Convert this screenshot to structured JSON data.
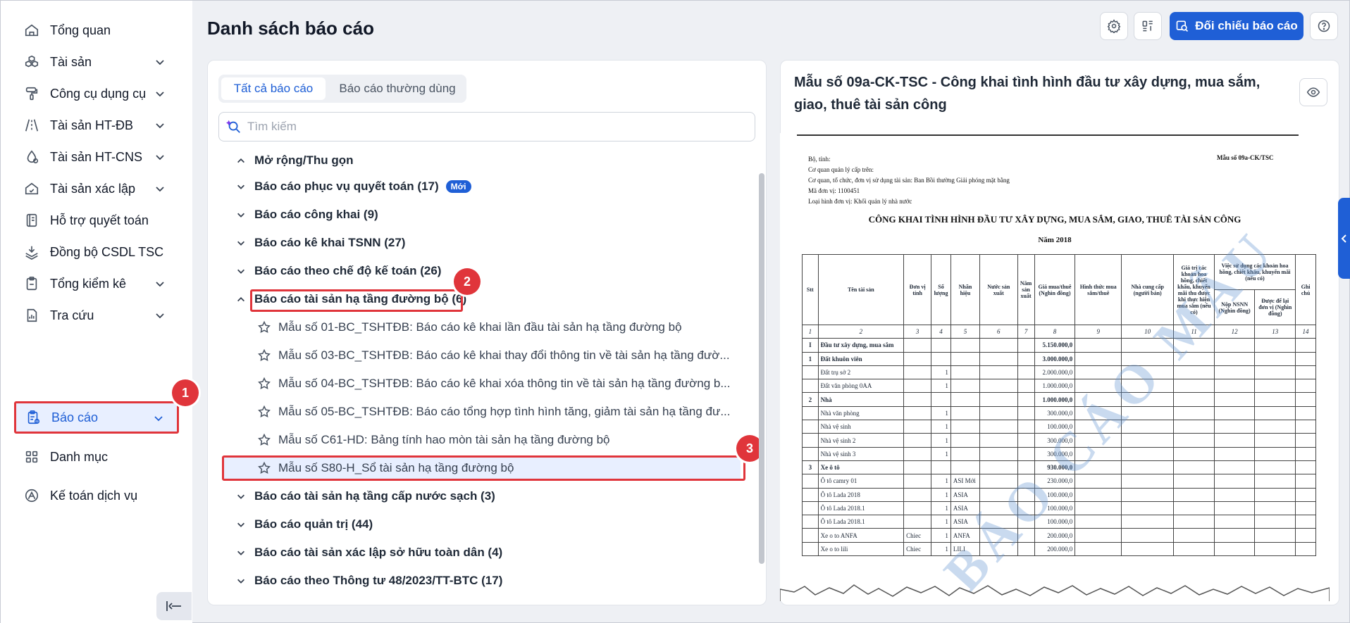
{
  "sidebar": {
    "items": [
      {
        "label": "Tổng quan",
        "icon": "home-icon",
        "chevron": false
      },
      {
        "label": "Tài sản",
        "icon": "cubes-icon",
        "chevron": true
      },
      {
        "label": "Công cụ dụng cụ",
        "icon": "paint-roller-icon",
        "chevron": true
      },
      {
        "label": "Tài sản HT-ĐB",
        "icon": "road-icon",
        "chevron": true
      },
      {
        "label": "Tài sản HT-CNS",
        "icon": "water-drop-icon",
        "chevron": true
      },
      {
        "label": "Tài sản xác lập",
        "icon": "house-check-icon",
        "chevron": true
      },
      {
        "label": "Hỗ trợ quyết toán",
        "icon": "book-icon",
        "chevron": false
      },
      {
        "label": "Đồng bộ CSDL TSC",
        "icon": "layers-sync-icon",
        "chevron": false
      },
      {
        "label": "Tổng kiểm kê",
        "icon": "clipboard-icon",
        "chevron": true
      },
      {
        "label": "Tra cứu",
        "icon": "file-chart-icon",
        "chevron": true
      },
      {
        "label": "Báo cáo",
        "icon": "report-icon",
        "chevron": true
      },
      {
        "label": "Danh mục",
        "icon": "grid-icon",
        "chevron": false
      },
      {
        "label": "Kế toán dịch vụ",
        "icon": "service-icon",
        "chevron": false
      }
    ]
  },
  "header": {
    "title": "Danh sách báo cáo",
    "compare_button": "Đối chiếu báo cáo"
  },
  "left_panel": {
    "tabs": [
      "Tất cả báo cáo",
      "Báo cáo thường dùng"
    ],
    "search_placeholder": "Tìm kiếm",
    "expand_collapse": "Mở rộng/Thu gọn",
    "new_badge": "Mới",
    "groups": [
      "Báo cáo phục vụ quyết toán (17)",
      "Báo cáo công khai (9)",
      "Báo cáo kê khai TSNN (27)",
      "Báo cáo theo chế độ kế toán (26)",
      "Báo cáo tài sản hạ tầng đường bộ (6)",
      "Báo cáo tài sản hạ tầng cấp nước sạch (3)",
      "Báo cáo quản trị (44)",
      "Báo cáo tài sản xác lập sở hữu toàn dân (4)",
      "Báo cáo theo Thông tư 48/2023/TT-BTC (17)"
    ],
    "children": [
      "Mẫu số 01-BC_TSHTĐB: Báo cáo kê khai lần đầu tài sản hạ tầng đường bộ",
      "Mẫu số 03-BC_TSHTĐB: Báo cáo kê khai thay đổi thông tin về tài sản hạ tầng đườ...",
      "Mẫu số 04-BC_TSHTĐB: Báo cáo kê khai xóa thông tin về tài sản hạ tầng đường b...",
      "Mẫu số 05-BC_TSHTĐB: Báo cáo tổng hợp tình hình tăng, giảm tài sản hạ tầng đư...",
      "Mẫu số C61-HD: Bảng tính hao mòn tài sản hạ tầng đường bộ",
      "Mẫu số S80-H_Sổ tài sản hạ tầng đường bộ"
    ],
    "markers": [
      "1",
      "2",
      "3"
    ]
  },
  "right_panel": {
    "title": "Mẫu số 09a-CK-TSC - Công khai tình hình đầu tư xây dựng, mua sắm, giao, thuê tài sản công",
    "doc": {
      "bo_tinh": "Bộ, tỉnh:",
      "mau_so": "Mẫu số 09a-CK/TSC",
      "co_quan": "Cơ quan quản lý cấp trên:",
      "don_vi": "Cơ quan, tổ chức, đơn vị sử dụng tài sản: Ban Bồi thường Giải phóng mặt bằng",
      "ma_don_vi": "Mã đơn vị: 1100451",
      "loai_hinh": "Loại hình đơn vị: Khối quản lý nhà nước",
      "heading": "CÔNG KHAI TÌNH HÌNH ĐẦU TƯ XÂY DỰNG, MUA SẮM, GIAO, THUÊ TÀI SẢN CÔNG",
      "year": "Năm 2018",
      "watermark": "BÁO CÁO MẪU",
      "columns": [
        "Stt",
        "Tên tài sản",
        "Đơn vị tính",
        "Số lượng",
        "Nhãn hiệu",
        "Nước sản xuất",
        "Năm sản xuất",
        "Giá mua/thuê (Nghìn đồng)",
        "Hình thức mua sắm/thuê",
        "Nhà cung cấp (người bán)",
        "Giá trị các khoản hoa hồng, chiết khấu, khuyến mãi thu được khi thực hiện mua sắm (nếu có)",
        "Việc sử dụng các khoản hoa hồng, chiết khấu, khuyến mãi (nếu có)",
        "Nộp NSNN (Nghìn đồng)",
        "Được để lại đơn vị (Nghìn đồng)",
        "Ghi chú"
      ],
      "col_numbers": [
        "1",
        "2",
        "3",
        "4",
        "5",
        "6",
        "7",
        "8",
        "9",
        "10",
        "11",
        "12",
        "13",
        "14"
      ],
      "rows": [
        {
          "stt": "I",
          "name": "Đầu tư xây dựng, mua sắm",
          "unit": "",
          "qty": "",
          "brand": "",
          "price": "5.150.000,0",
          "bold": true
        },
        {
          "stt": "1",
          "name": "Đất khuôn viên",
          "unit": "",
          "qty": "",
          "brand": "",
          "price": "3.000.000,0",
          "bold": true
        },
        {
          "stt": "",
          "name": "Đất trụ sở 2",
          "unit": "",
          "qty": "1",
          "brand": "",
          "price": "2.000.000,0",
          "bold": false
        },
        {
          "stt": "",
          "name": "Đất văn phòng 0AA",
          "unit": "",
          "qty": "1",
          "brand": "",
          "price": "1.000.000,0",
          "bold": false
        },
        {
          "stt": "2",
          "name": "Nhà",
          "unit": "",
          "qty": "",
          "brand": "",
          "price": "1.000.000,0",
          "bold": true
        },
        {
          "stt": "",
          "name": "Nhà văn phòng",
          "unit": "",
          "qty": "1",
          "brand": "",
          "price": "300.000,0",
          "bold": false
        },
        {
          "stt": "",
          "name": "Nhà vệ sinh",
          "unit": "",
          "qty": "1",
          "brand": "",
          "price": "100.000,0",
          "bold": false
        },
        {
          "stt": "",
          "name": "Nhà vệ sinh 2",
          "unit": "",
          "qty": "1",
          "brand": "",
          "price": "300.000,0",
          "bold": false
        },
        {
          "stt": "",
          "name": "Nhà vệ sinh 3",
          "unit": "",
          "qty": "1",
          "brand": "",
          "price": "300.000,0",
          "bold": false
        },
        {
          "stt": "3",
          "name": "Xe ô tô",
          "unit": "",
          "qty": "",
          "brand": "",
          "price": "930.000,0",
          "bold": true
        },
        {
          "stt": "",
          "name": "Ô tô camry 01",
          "unit": "",
          "qty": "1",
          "brand": "ASI Mới",
          "price": "230.000,0",
          "bold": false
        },
        {
          "stt": "",
          "name": "Ô tô Lada 2018",
          "unit": "",
          "qty": "1",
          "brand": "ASIA",
          "price": "100.000,0",
          "bold": false
        },
        {
          "stt": "",
          "name": "Ô tô Lada 2018.1",
          "unit": "",
          "qty": "1",
          "brand": "ASIA",
          "price": "100.000,0",
          "bold": false
        },
        {
          "stt": "",
          "name": "Ô tô Lada 2018.1",
          "unit": "",
          "qty": "1",
          "brand": "ASIA",
          "price": "100.000,0",
          "bold": false
        },
        {
          "stt": "",
          "name": "Xe o to ANFA",
          "unit": "Chiec",
          "qty": "1",
          "brand": "ANFA",
          "price": "200.000,0",
          "bold": false
        },
        {
          "stt": "",
          "name": "Xe o to lili",
          "unit": "Chiec",
          "qty": "1",
          "brand": "LILI",
          "price": "200.000,0",
          "bold": false
        }
      ]
    }
  }
}
